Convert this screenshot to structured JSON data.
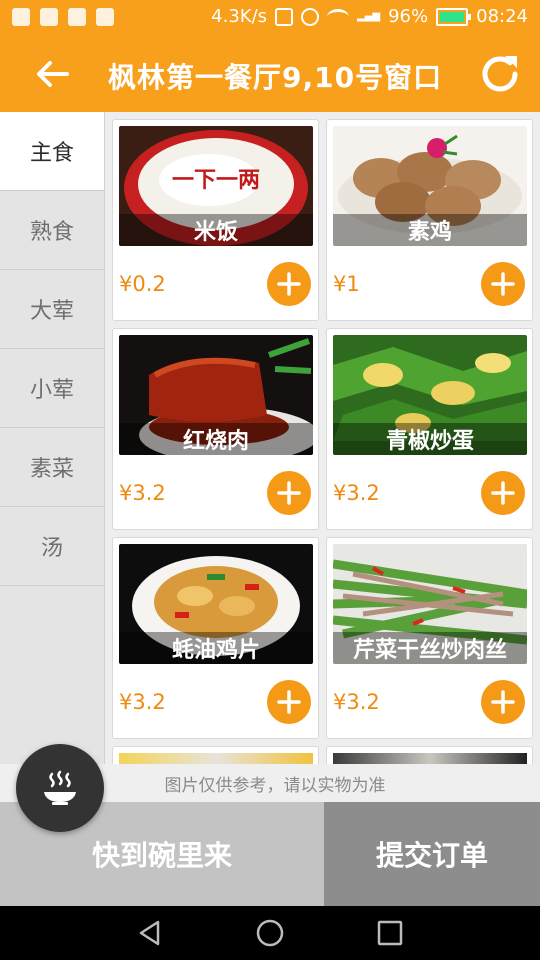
{
  "status_bar": {
    "speed": "4.3K/s",
    "battery": "96%",
    "time": "08:24"
  },
  "appbar": {
    "title": "枫林第一餐厅9,10号窗口"
  },
  "categories": [
    {
      "label": "主食",
      "active": true
    },
    {
      "label": "熟食"
    },
    {
      "label": "大荤"
    },
    {
      "label": "小荤"
    },
    {
      "label": "素菜"
    },
    {
      "label": "汤"
    }
  ],
  "dishes": [
    {
      "name": "米饭",
      "price": "¥0.2",
      "photo_text": "一下一两"
    },
    {
      "name": "素鸡",
      "price": "¥1"
    },
    {
      "name": "红烧肉",
      "price": "¥3.2"
    },
    {
      "name": "青椒炒蛋",
      "price": "¥3.2"
    },
    {
      "name": "蚝油鸡片",
      "price": "¥3.2"
    },
    {
      "name": "芹菜干丝炒肉丝",
      "price": "¥3.2"
    }
  ],
  "notice": "图片仅供参考，请以实物为准",
  "bottom": {
    "bowl_label": "快到碗里来",
    "submit_label": "提交订单"
  },
  "colors": {
    "accent": "#f8a01c",
    "add_button": "#f59a16",
    "price": "#ef8a10"
  }
}
